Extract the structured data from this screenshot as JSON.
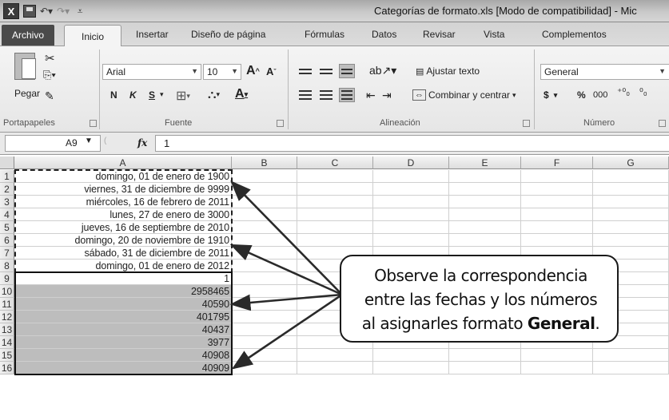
{
  "window": {
    "title": "Categorías de formato.xls  [Modo de compatibilidad]  -  Mic",
    "qat": [
      "excel-icon",
      "save-icon",
      "undo-icon",
      "redo-icon",
      "customize-icon"
    ]
  },
  "tabs": {
    "file": "Archivo",
    "active": "Inicio",
    "items": [
      "Insertar",
      "Diseño de página",
      "Fórmulas",
      "Datos",
      "Revisar",
      "Vista",
      "Complementos"
    ]
  },
  "ribbon": {
    "clipboard": {
      "paste": "Pegar",
      "label": "Portapapeles"
    },
    "font": {
      "name": "Arial",
      "size": "10",
      "bold": "N",
      "italic": "K",
      "underline": "S",
      "label": "Fuente"
    },
    "alignment": {
      "wrap": "Ajustar texto",
      "merge": "Combinar y centrar",
      "label": "Alineación"
    },
    "number": {
      "format": "General",
      "label": "Número",
      "currency": "$",
      "percent": "%",
      "thousands": "000",
      "inc_decimal": "⁺⁰₀",
      "dec_decimal": "⁰₀"
    }
  },
  "formula_bar": {
    "cell_ref": "A9",
    "fx": "fx",
    "value": "1"
  },
  "grid": {
    "columns": [
      "A",
      "B",
      "C",
      "D",
      "E",
      "F",
      "G"
    ],
    "rows": [
      {
        "num": "1",
        "a": "domingo, 01 de enero de 1900"
      },
      {
        "num": "2",
        "a": "viernes, 31 de diciembre de 9999"
      },
      {
        "num": "3",
        "a": "miércoles, 16 de febrero de 2011"
      },
      {
        "num": "4",
        "a": "lunes, 27 de enero de 3000"
      },
      {
        "num": "5",
        "a": "jueves, 16 de septiembre de 2010"
      },
      {
        "num": "6",
        "a": "domingo, 20 de noviembre de 1910"
      },
      {
        "num": "7",
        "a": "sábado, 31 de diciembre de 2011"
      },
      {
        "num": "8",
        "a": "domingo, 01 de enero de 2012"
      },
      {
        "num": "9",
        "a": "1"
      },
      {
        "num": "10",
        "a": "2958465"
      },
      {
        "num": "11",
        "a": "40590"
      },
      {
        "num": "12",
        "a": "401795"
      },
      {
        "num": "13",
        "a": "40437"
      },
      {
        "num": "14",
        "a": "3977"
      },
      {
        "num": "15",
        "a": "40908"
      },
      {
        "num": "16",
        "a": "40909"
      }
    ]
  },
  "callout": {
    "line1": "Observe la correspondencia",
    "line2": "entre las fechas y los números",
    "line3_prefix": "al asignarles formato ",
    "line3_bold": "General",
    "line3_suffix": "."
  }
}
